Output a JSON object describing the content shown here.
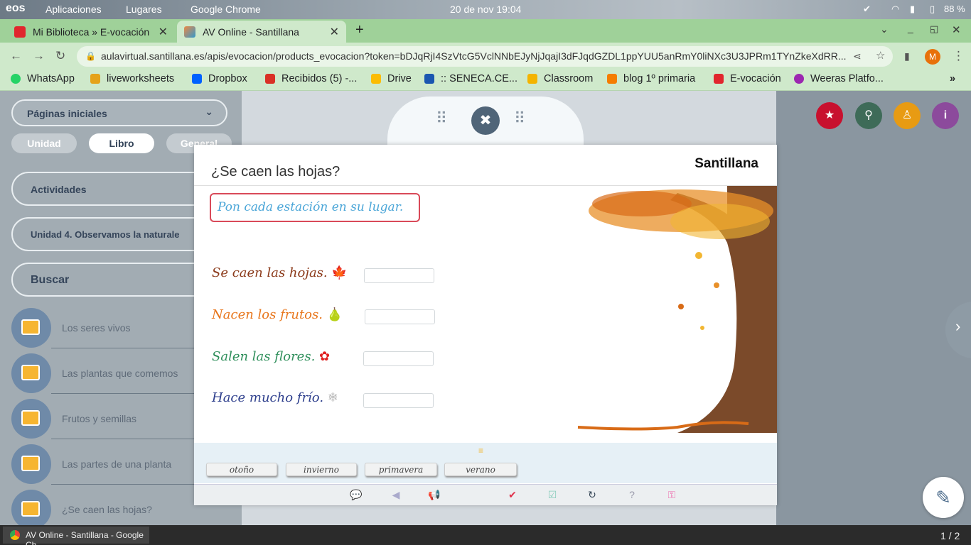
{
  "system_bar": {
    "logo": "eos",
    "menu_apps": "Aplicaciones",
    "menu_places": "Lugares",
    "menu_chrome": "Google Chrome",
    "datetime": "20 de nov  19:04",
    "battery": "88 %"
  },
  "browser": {
    "tabs": [
      {
        "title": "Mi Biblioteca » E-vocación",
        "active": false
      },
      {
        "title": "AV Online - Santillana",
        "active": true
      }
    ],
    "new_tab": "+",
    "url": "aulavirtual.santillana.es/apis/evocacion/products_evocacion?token=bDJqRjI4SzVtcG5VclNNbEJyNjJqajI3dFJqdGZDL1ppYUU5anRmY0liNXc3U3JPRm1TYnZkeXdRR...",
    "profile_initial": "M",
    "bookmarks": [
      {
        "label": "WhatsApp",
        "color": "#25d366"
      },
      {
        "label": "liveworksheets",
        "color": "#e5a21a"
      },
      {
        "label": "Dropbox",
        "color": "#0061ff"
      },
      {
        "label": "Recibidos (5) -...",
        "color": "#d93025"
      },
      {
        "label": "Drive",
        "color": "#fbbc04"
      },
      {
        "label": ":: SENECA.CE...",
        "color": "#1a56b0"
      },
      {
        "label": "Classroom",
        "color": "#f4b400"
      },
      {
        "label": "blog 1º primaria",
        "color": "#f57d00"
      },
      {
        "label": "E-vocación",
        "color": "#e1262d"
      },
      {
        "label": "Weeras Platfo...",
        "color": "#9c27b0"
      }
    ],
    "more": "»"
  },
  "sidebar": {
    "dropdown": "Páginas iniciales",
    "tabs": [
      "Unidad",
      "Libro",
      "General"
    ],
    "actividades": "Actividades",
    "unidad": "Unidad 4. Observamos la naturale",
    "buscar": "Buscar",
    "items": [
      "Los seres vivos",
      "Las plantas que comemos",
      "Frutos y semillas",
      "Las partes de una planta",
      "¿Se caen las hojas?"
    ]
  },
  "activity": {
    "title": "¿Se caen las hojas?",
    "brand": "Santillana",
    "instruction": "Pon cada estación en su lugar.",
    "sentences": [
      {
        "text": "Se caen las hojas.",
        "color": "#8b3a1a",
        "icon": "leaf-icon",
        "answer": ""
      },
      {
        "text": "Nacen los frutos.",
        "color": "#e8751a",
        "icon": "pear-icon",
        "answer": ""
      },
      {
        "text": "Salen las flores.",
        "color": "#2f8f5b",
        "icon": "flower-icon",
        "answer": ""
      },
      {
        "text": "Hace mucho frío.",
        "color": "#2d3e8c",
        "icon": "snowflake-icon",
        "answer": ""
      }
    ],
    "options": [
      "otoño",
      "invierno",
      "primavera",
      "verano"
    ]
  },
  "taskbar": {
    "window": "AV Online - Santillana - Google Ch...",
    "workspace": "1 / 2"
  }
}
